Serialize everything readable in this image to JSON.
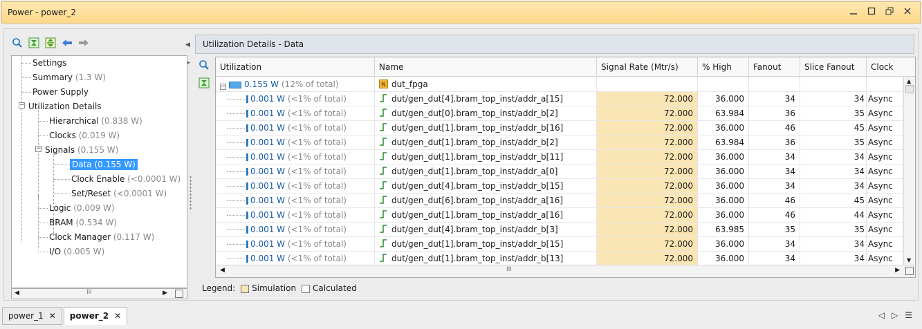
{
  "window": {
    "title": "Power - power_2",
    "controls": [
      "minimize-icon",
      "maximize-icon",
      "restore-icon",
      "close-icon"
    ]
  },
  "left_toolbar": [
    "search-icon",
    "collapse-all-icon",
    "expand-all-icon",
    "back-arrow-icon",
    "forward-arrow-icon"
  ],
  "tree": [
    {
      "label": "Settings",
      "value": ""
    },
    {
      "label": "Summary",
      "value": "(1.3 W)"
    },
    {
      "label": "Power Supply",
      "value": ""
    },
    {
      "label": "Utilization Details",
      "value": ""
    },
    {
      "label": "Hierarchical",
      "value": "(0.838 W)"
    },
    {
      "label": "Clocks",
      "value": "(0.019 W)"
    },
    {
      "label": "Signals",
      "value": "(0.155 W)"
    },
    {
      "label": "Data (0.155 W)",
      "value": ""
    },
    {
      "label": "Clock Enable",
      "value": "(<0.0001 W)"
    },
    {
      "label": "Set/Reset",
      "value": "(<0.0001 W)"
    },
    {
      "label": "Logic",
      "value": "(0.009 W)"
    },
    {
      "label": "BRAM",
      "value": "(0.534 W)"
    },
    {
      "label": "Clock Manager",
      "value": "(0.117 W)"
    },
    {
      "label": "I/O",
      "value": "(0.005 W)"
    }
  ],
  "details": {
    "tab_title": "Utilization Details - Data",
    "columns": [
      "Utilization",
      "Name",
      "Signal Rate (Mtr/s)",
      "% High",
      "Fanout",
      "Slice Fanout",
      "Clock"
    ],
    "root": {
      "util": "0.155 W",
      "pct": "(12% of total)",
      "name": "dut_fpga"
    },
    "rows": [
      {
        "util": "0.001 W",
        "pct": "(<1% of total)",
        "name": "dut/gen_dut[4].bram_top_inst/addr_a[15]",
        "rate": "72.000",
        "high": "36.000",
        "fanout": "34",
        "slice": "34",
        "clock": "Async"
      },
      {
        "util": "0.001 W",
        "pct": "(<1% of total)",
        "name": "dut/gen_dut[0].bram_top_inst/addr_b[2]",
        "rate": "72.000",
        "high": "63.984",
        "fanout": "36",
        "slice": "35",
        "clock": "Async"
      },
      {
        "util": "0.001 W",
        "pct": "(<1% of total)",
        "name": "dut/gen_dut[1].bram_top_inst/addr_b[16]",
        "rate": "72.000",
        "high": "36.000",
        "fanout": "46",
        "slice": "45",
        "clock": "Async"
      },
      {
        "util": "0.001 W",
        "pct": "(<1% of total)",
        "name": "dut/gen_dut[1].bram_top_inst/addr_b[2]",
        "rate": "72.000",
        "high": "63.984",
        "fanout": "36",
        "slice": "35",
        "clock": "Async"
      },
      {
        "util": "0.001 W",
        "pct": "(<1% of total)",
        "name": "dut/gen_dut[1].bram_top_inst/addr_b[11]",
        "rate": "72.000",
        "high": "36.000",
        "fanout": "34",
        "slice": "34",
        "clock": "Async"
      },
      {
        "util": "0.001 W",
        "pct": "(<1% of total)",
        "name": "dut/gen_dut[1].bram_top_inst/addr_a[0]",
        "rate": "72.000",
        "high": "36.000",
        "fanout": "34",
        "slice": "34",
        "clock": "Async"
      },
      {
        "util": "0.001 W",
        "pct": "(<1% of total)",
        "name": "dut/gen_dut[4].bram_top_inst/addr_b[15]",
        "rate": "72.000",
        "high": "36.000",
        "fanout": "34",
        "slice": "34",
        "clock": "Async"
      },
      {
        "util": "0.001 W",
        "pct": "(<1% of total)",
        "name": "dut/gen_dut[6].bram_top_inst/addr_a[16]",
        "rate": "72.000",
        "high": "36.000",
        "fanout": "46",
        "slice": "45",
        "clock": "Async"
      },
      {
        "util": "0.001 W",
        "pct": "(<1% of total)",
        "name": "dut/gen_dut[1].bram_top_inst/addr_a[16]",
        "rate": "72.000",
        "high": "36.000",
        "fanout": "46",
        "slice": "44",
        "clock": "Async"
      },
      {
        "util": "0.001 W",
        "pct": "(<1% of total)",
        "name": "dut/gen_dut[4].bram_top_inst/addr_b[3]",
        "rate": "72.000",
        "high": "63.985",
        "fanout": "35",
        "slice": "35",
        "clock": "Async"
      },
      {
        "util": "0.001 W",
        "pct": "(<1% of total)",
        "name": "dut/gen_dut[1].bram_top_inst/addr_b[15]",
        "rate": "72.000",
        "high": "36.000",
        "fanout": "34",
        "slice": "34",
        "clock": "Async"
      },
      {
        "util": "0.001 W",
        "pct": "(<1% of total)",
        "name": "dut/gen_dut[1].bram_top_inst/addr_b[13]",
        "rate": "72.000",
        "high": "36.000",
        "fanout": "34",
        "slice": "34",
        "clock": "Async"
      }
    ]
  },
  "legend": {
    "label": "Legend:",
    "simulation": "Simulation",
    "calculated": "Calculated",
    "simulation_color": "#fae5b4"
  },
  "bottom_tabs": [
    {
      "label": "power_1",
      "active": false
    },
    {
      "label": "power_2",
      "active": true
    }
  ],
  "bottom_nav": [
    "prev-tab-icon",
    "next-tab-icon",
    "tab-list-icon"
  ],
  "colors": {
    "titlebar": "#ffd98a",
    "selection": "#3399ff",
    "util_text": "#1a5aa8"
  }
}
